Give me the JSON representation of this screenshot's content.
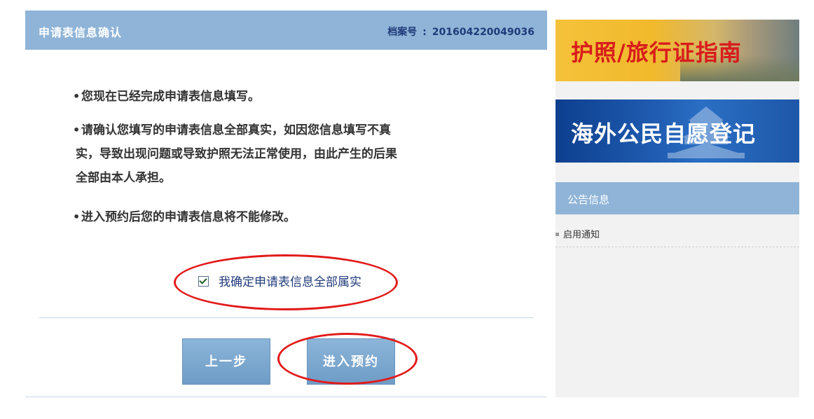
{
  "main": {
    "title": "申请表信息确认",
    "file_no_label": "档案号",
    "file_no_sep": ":",
    "file_no": "201604220049036",
    "bullet": "•",
    "note1": "您现在已经完成申请表信息填写。",
    "note2_line1": "请确认您填写的申请表信息全部真实，如因您信息填写不真",
    "note2_line2": "实，导致出现问题或导致护照无法正常使用，由此产生的后果",
    "note2_line3": "全部由本人承担。",
    "note3": "进入预约后您的申请表信息将不能修改。",
    "confirm_label": "我确定申请表信息全部属实",
    "confirm_checked": true,
    "prev_button": "上一步",
    "next_button": "进入预约"
  },
  "side": {
    "banner1_text": "护照/旅行证指南",
    "banner2_text": "海外公民自愿登记",
    "notice_title": "公告信息",
    "notice_items": [
      {
        "label": "启用通知"
      }
    ]
  },
  "colors": {
    "header": "#8fb4d7",
    "highlight_ring": "#e21a1a",
    "button": "#7aa6cf"
  }
}
